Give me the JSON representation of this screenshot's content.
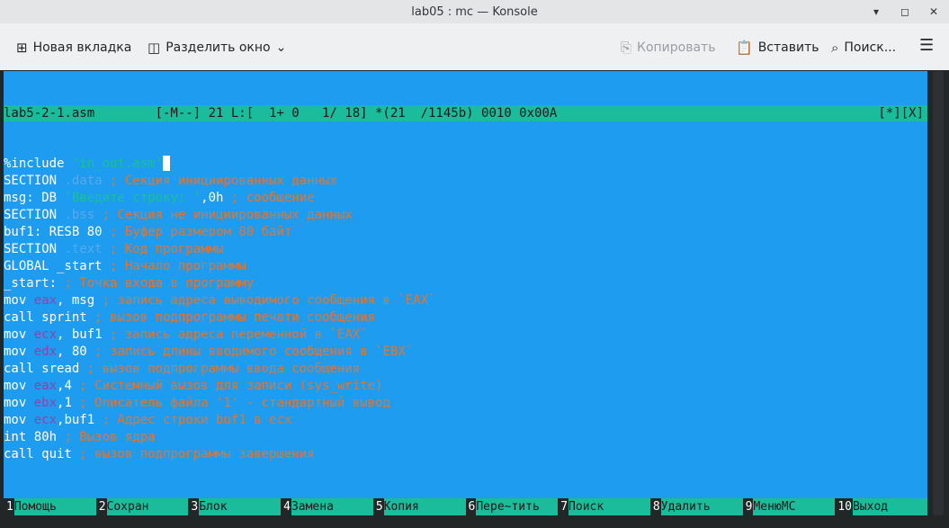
{
  "window": {
    "title": "lab05 : mc — Konsole"
  },
  "toolbar": {
    "new_tab": "Новая вкладка",
    "split": "Разделить окно",
    "copy": "Копировать",
    "paste": "Вставить",
    "search": "Поиск..."
  },
  "editor": {
    "status_left": "lab5-2-1.asm        [-M--] 21 L:[  1+ 0   1/ 18] *(21  /1145b) 0010 0x00A",
    "status_right": "[*][X]",
    "lines": [
      [
        [
          "t",
          "%include "
        ],
        [
          "str",
          "'in_out.asm'"
        ]
      ],
      [
        [
          "t",
          "SECTION "
        ],
        [
          "kw",
          ".data"
        ],
        [
          "cm",
          " ; Секция инициированных данных"
        ]
      ],
      [
        [
          "t",
          "msg: DB "
        ],
        [
          "str",
          "'Введите строку: '"
        ],
        [
          "t",
          ",0h"
        ],
        [
          "cm",
          " ; сообщение"
        ]
      ],
      [
        [
          "t",
          "SECTION "
        ],
        [
          "kw",
          ".bss"
        ],
        [
          "cm",
          " ; Секция не инициированных данных"
        ]
      ],
      [
        [
          "t",
          "buf1: RESB 80"
        ],
        [
          "cm",
          " ; Буфер размером 80 байт"
        ]
      ],
      [
        [
          "t",
          "SECTION "
        ],
        [
          "kw",
          ".text"
        ],
        [
          "cm",
          " ; Код программы"
        ]
      ],
      [
        [
          "t",
          "GLOBAL _start"
        ],
        [
          "cm",
          " ; Начало программы"
        ]
      ],
      [
        [
          "t",
          "_start:"
        ],
        [
          "cm",
          " ; Точка входа в программу"
        ]
      ],
      [
        [
          "t",
          "mov "
        ],
        [
          "reg",
          "eax"
        ],
        [
          "t",
          ", msg"
        ],
        [
          "cm",
          " ; запись адреса выводимого сообщения в `EAX`"
        ]
      ],
      [
        [
          "t",
          "call sprint"
        ],
        [
          "cm",
          " ; вызов подпрограммы печати сообщения"
        ]
      ],
      [
        [
          "t",
          "mov "
        ],
        [
          "reg",
          "ecx"
        ],
        [
          "t",
          ", buf1"
        ],
        [
          "cm",
          " ; запись адреса переменной в `EAX`"
        ]
      ],
      [
        [
          "t",
          "mov "
        ],
        [
          "reg",
          "edx"
        ],
        [
          "t",
          ", 80"
        ],
        [
          "cm",
          " ; запись длины вводимого сообщения в `EBX`"
        ]
      ],
      [
        [
          "t",
          "call sread"
        ],
        [
          "cm",
          " ; вызов подпрограммы ввода сообщения"
        ]
      ],
      [
        [
          "t",
          "mov "
        ],
        [
          "reg",
          "eax"
        ],
        [
          "t",
          ",4"
        ],
        [
          "cm",
          " ; Системный вызов для записи (sys_write)"
        ]
      ],
      [
        [
          "t",
          "mov "
        ],
        [
          "reg",
          "ebx"
        ],
        [
          "t",
          ",1"
        ],
        [
          "cm",
          " ; Описатель файла '1' - стандартный вывод"
        ]
      ],
      [
        [
          "t",
          "mov "
        ],
        [
          "reg",
          "ecx"
        ],
        [
          "t",
          ",buf1"
        ],
        [
          "cm",
          " ; Адрес строки buf1 в ecx"
        ]
      ],
      [
        [
          "t",
          "int 80h"
        ],
        [
          "cm",
          " ; Вызов ядра"
        ]
      ],
      [
        [
          "t",
          "call quit"
        ],
        [
          "cm",
          " ; вызов подпрограммы завершения"
        ]
      ]
    ]
  },
  "fkeys": [
    {
      "n": "1",
      "l": "Помощь"
    },
    {
      "n": "2",
      "l": "Сохран"
    },
    {
      "n": "3",
      "l": "Блок"
    },
    {
      "n": "4",
      "l": "Замена"
    },
    {
      "n": "5",
      "l": "Копия"
    },
    {
      "n": "6",
      "l": "Пере~тить"
    },
    {
      "n": "7",
      "l": "Поиск"
    },
    {
      "n": "8",
      "l": "Удалить"
    },
    {
      "n": "9",
      "l": "МенюMC"
    },
    {
      "n": "10",
      "l": "Выход"
    }
  ]
}
